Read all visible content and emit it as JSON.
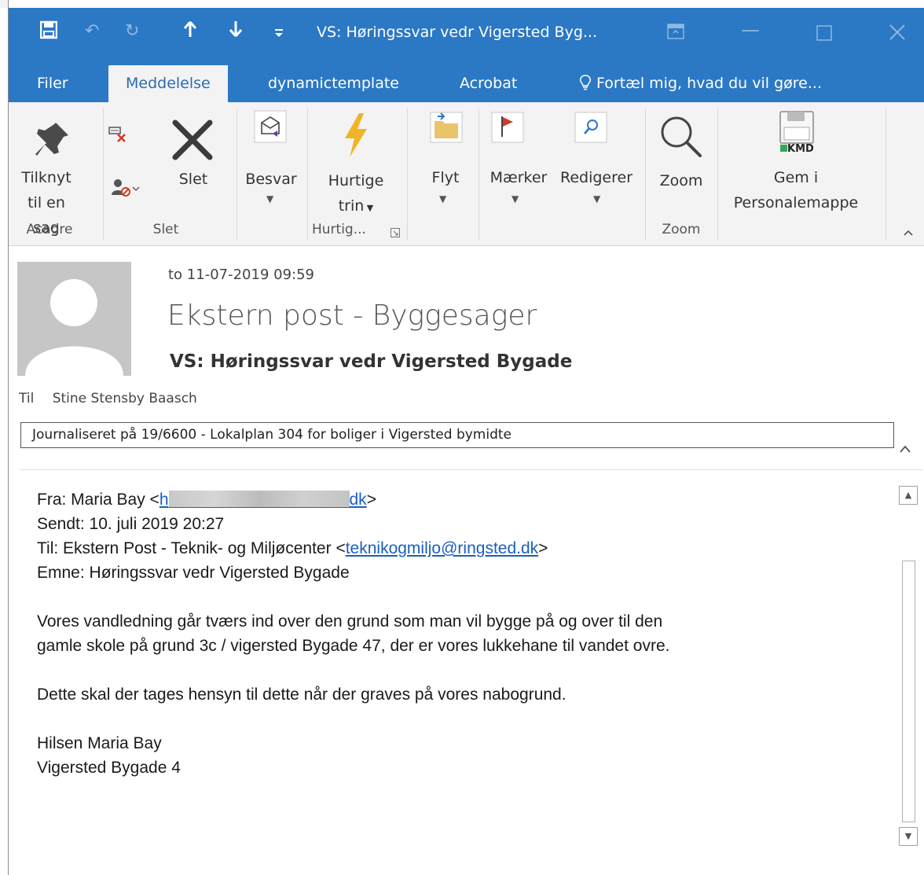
{
  "window": {
    "title": "VS: Høringssvar vedr Vigersted Byg...",
    "quick_access": {
      "save_icon": "save-icon",
      "undo_icon": "undo-icon",
      "redo_icon": "redo-icon",
      "up_icon": "arrow-up-icon",
      "down_icon": "arrow-down-icon",
      "customize_icon": "customize-quick-access-icon"
    },
    "accent_color": "#2b78c5"
  },
  "tabs": [
    {
      "label": "Filer",
      "active": false
    },
    {
      "label": "Meddelelse",
      "active": true
    },
    {
      "label": "dynamictemplate",
      "active": false
    },
    {
      "label": "Acrobat",
      "active": false
    },
    {
      "label": "Fortæl mig, hvad du vil gøre...",
      "active": false
    }
  ],
  "ribbon": {
    "attach_case": {
      "line1": "Tilknyt",
      "line2": "til en sag"
    },
    "delete": {
      "label": "Slet"
    },
    "reply": {
      "label": "Besvar"
    },
    "quick_steps": {
      "line1": "Hurtige",
      "line2": "trin"
    },
    "move": {
      "label": "Flyt"
    },
    "tags": {
      "label": "Mærker"
    },
    "editing": {
      "label": "Redigerer"
    },
    "zoom": {
      "label": "Zoom"
    },
    "save_personnel": {
      "line1": "Gem i",
      "line2": "Personalemappe",
      "badge": "KMD"
    },
    "groups": {
      "acadre": "Acadre",
      "delete": "Slet",
      "quick_steps": "Hurtig...",
      "zoom": "Zoom"
    }
  },
  "message": {
    "date": "to 11-07-2019 09:59",
    "sender": "Ekstern post - Byggesager",
    "subject": "VS: Høringssvar vedr Vigersted Bygade",
    "to_label": "Til",
    "to_value": "Stine Stensby Baasch",
    "journal": "Journaliseret på 19/6600 - Lokalplan 304 for boliger i Vigersted bymidte"
  },
  "body": {
    "from_prefix": "Fra: Maria Bay <",
    "from_email_visible_start": "h",
    "from_email_visible_end": "dk",
    "from_suffix": ">",
    "sent": "Sendt: 10. juli 2019 20:27",
    "to_prefix": "Til: Ekstern Post - Teknik- og Miljøcenter <",
    "to_email": "teknikogmiljo@ringsted.dk",
    "to_suffix": ">",
    "subject": "Emne: Høringssvar vedr Vigersted Bygade",
    "para1_line1": "Vores vandledning går tværs ind over den grund som man vil bygge på og over til den",
    "para1_line2": "gamle skole på grund 3c / vigersted Bygade 47, der er vores lukkehane til vandet ovre.",
    "para2": "Dette skal der tages hensyn til dette når der graves på vores nabogrund.",
    "sign1": "Hilsen Maria Bay",
    "sign2": "Vigersted Bygade 4"
  }
}
